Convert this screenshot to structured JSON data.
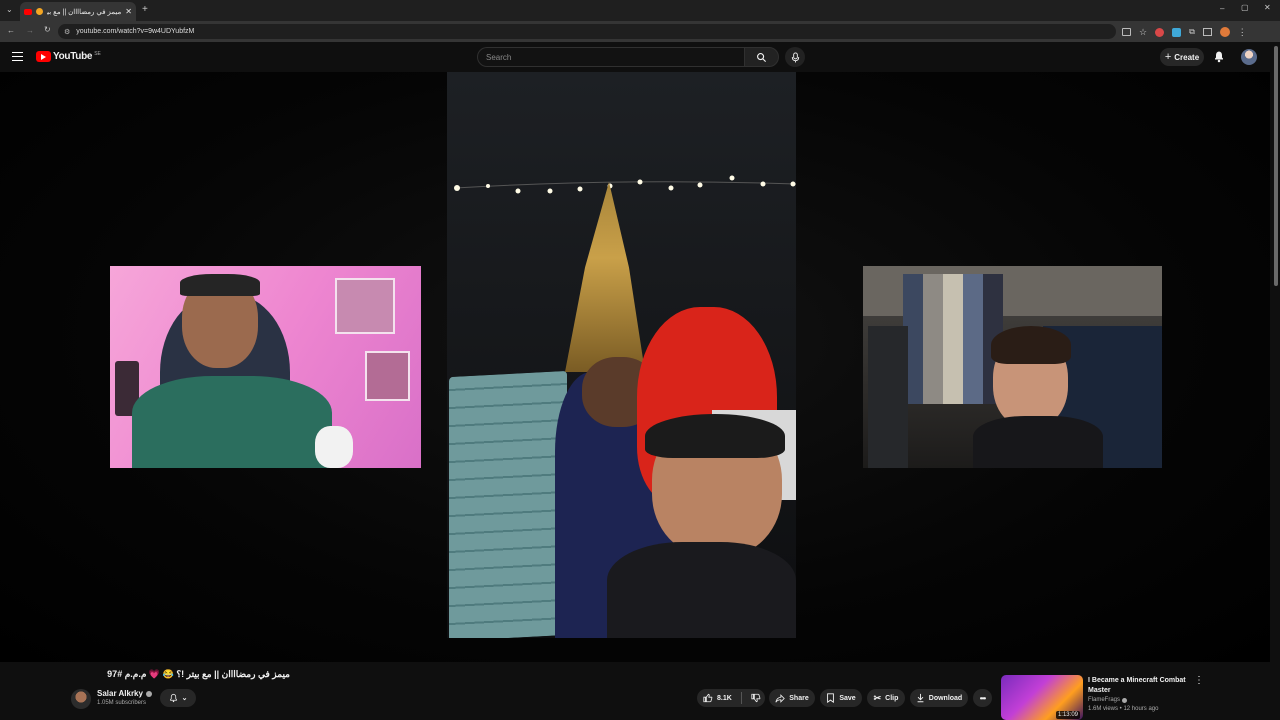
{
  "browser": {
    "tab_title": "ميمز في رمضاااان || مع بيتر !؟",
    "url": "youtube.com/watch?v=9w4UDYubfzM"
  },
  "masthead": {
    "logo_text": "YouTube",
    "region": "SE",
    "search_placeholder": "Search",
    "create_label": "Create"
  },
  "video": {
    "title": "ميمز في رمضاااان || مع بيتر !؟ 😂 💗 م.م.م #97",
    "channel_name": "Salar Alkrky",
    "subscribers": "1.05M subscribers"
  },
  "actions": {
    "likes": "8.1K",
    "share": "Share",
    "save": "Save",
    "clip": "Clip",
    "download": "Download"
  },
  "recommendation": {
    "title": "I Became a Minecraft Combat Master",
    "channel": "FlameFrags",
    "meta": "1.6M views • 12 hours ago",
    "duration": "1:13:09"
  },
  "colors": {
    "brand_red": "#ff0000",
    "background": "#0f0f0f",
    "chrome_toolbar": "#353535"
  }
}
